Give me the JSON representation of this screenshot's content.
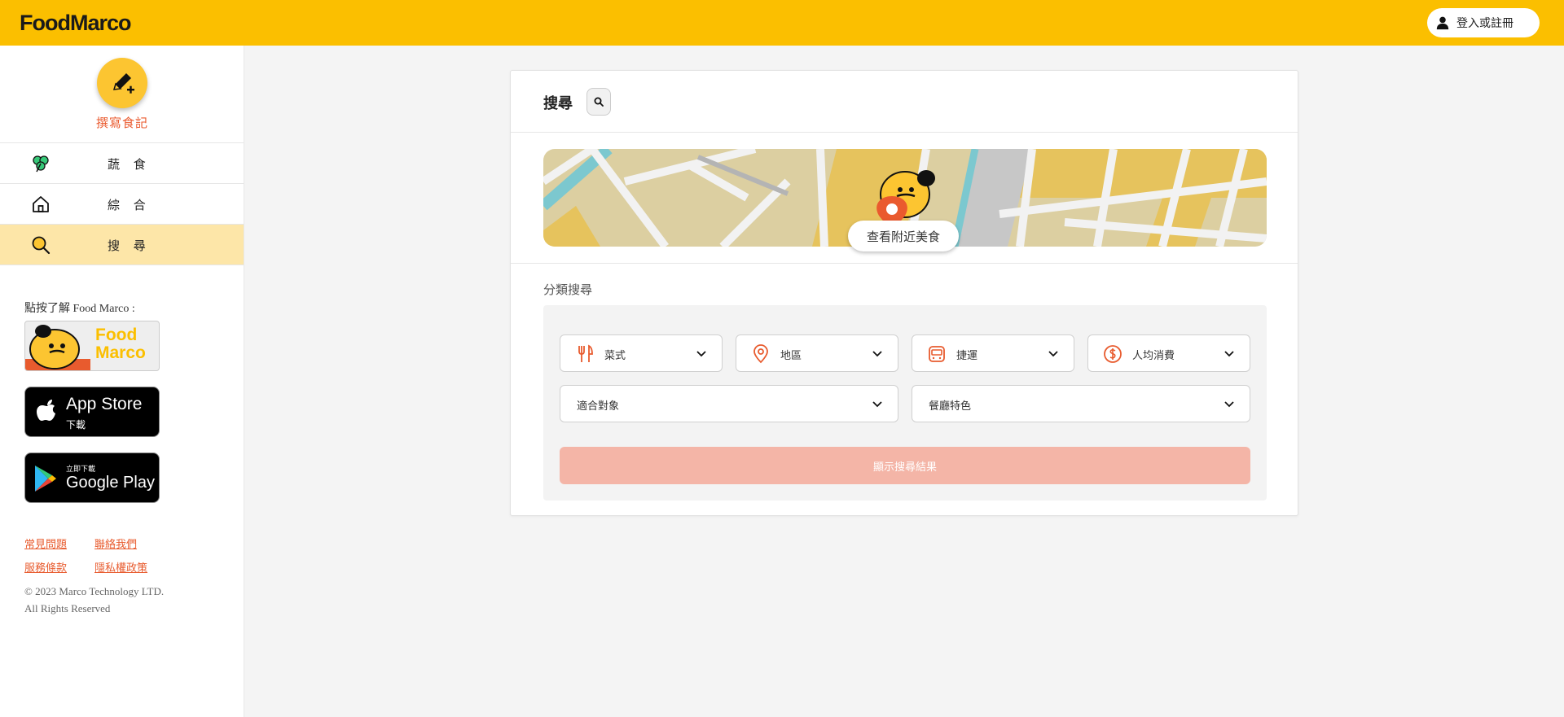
{
  "header": {
    "logo": "FoodMarco",
    "login_label": "登入或註冊"
  },
  "sidebar": {
    "write_label": "撰寫食記",
    "nav": [
      {
        "label": "蔬 食",
        "icon": "clover-icon"
      },
      {
        "label": "綜 合",
        "icon": "home-icon"
      },
      {
        "label": "搜 尋",
        "icon": "search-icon"
      }
    ],
    "intro_text": "點按了解 Food Marco :",
    "brand_badge": {
      "line1": "Food",
      "line2": "Marco"
    },
    "app_store": {
      "big": "App Store",
      "small": "下載"
    },
    "google_play": {
      "big": "Google Play",
      "small": "立即下載"
    },
    "links": [
      "常見問題",
      "聯絡我們",
      "服務條款",
      "隱私權政策"
    ],
    "copyright_1": "© 2023 Marco Technology LTD.",
    "copyright_2": "All Rights Reserved"
  },
  "main": {
    "title": "搜尋",
    "nearby_label": "查看附近美食",
    "category_label": "分類搜尋",
    "filters": [
      {
        "label": "菜式",
        "icon": "utensils-icon"
      },
      {
        "label": "地區",
        "icon": "location-pin-icon"
      },
      {
        "label": "捷運",
        "icon": "metro-icon"
      },
      {
        "label": "人均消費",
        "icon": "dollar-icon"
      },
      {
        "label": "適合對象"
      },
      {
        "label": "餐廳特色"
      }
    ],
    "submit_label": "顯示搜尋結果"
  },
  "colors": {
    "brand_yellow": "#fbbf00",
    "accent_orange": "#ea5a2e",
    "active_nav": "#fde6a8",
    "submit_disabled": "#f4b5a7"
  }
}
